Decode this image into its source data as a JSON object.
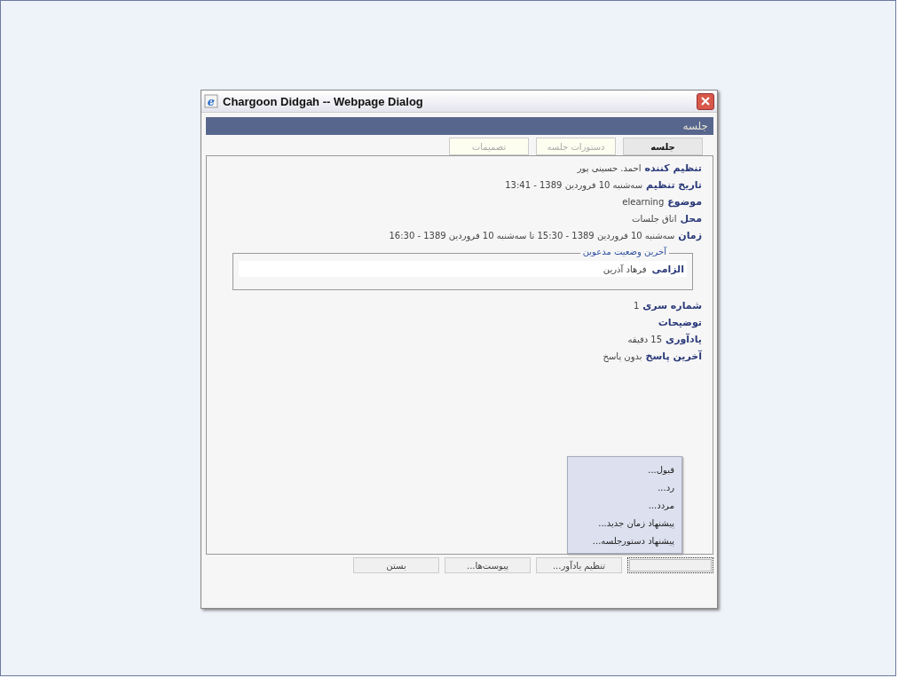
{
  "window": {
    "icon_letter": "e",
    "title": "Chargoon Didgah -- Webpage Dialog"
  },
  "header": {
    "title": "جلسه"
  },
  "tabs": [
    {
      "label": "جلسه",
      "selected": true
    },
    {
      "label": "دستورات جلسه",
      "selected": false
    },
    {
      "label": "تصمیمات",
      "selected": false
    }
  ],
  "fields_top": [
    {
      "label": "تنظیم کننده",
      "value": "احمد. حسینی پور"
    },
    {
      "label": "تاریخ تنظیم",
      "value": "سه‌شنبه 10 فروردین 1389 - 13:41"
    },
    {
      "label": "موضوع",
      "value": "elearning"
    },
    {
      "label": "محل",
      "value": "اتاق جلسات"
    },
    {
      "label": "زمان",
      "value": "سه‌شنبه 10 فروردین 1389 - 15:30 تا سه‌شنبه 10 فروردین 1389 - 16:30"
    }
  ],
  "invitees": {
    "legend": "آخرین وضعیت مدعوین",
    "rows": [
      {
        "status": "الزامی",
        "name": "فرهاد آذرین"
      }
    ]
  },
  "fields_bottom": [
    {
      "label": "شماره سری",
      "value": "1"
    },
    {
      "label": "توضیحات"
    },
    {
      "label": "یادآوری",
      "value": "15 دقیقه"
    },
    {
      "label": "آخرین پاسخ",
      "value": "بدون پاسخ"
    }
  ],
  "buttons": [
    {
      "focused": true
    },
    {
      "label": "تنظیم یادآور...",
      "focused": false
    },
    {
      "label": "پیوست‌ها...",
      "focused": false
    },
    {
      "label": "بستن",
      "focused": false
    }
  ],
  "menu": {
    "items": [
      "قبول...",
      "رد...",
      "مردد...",
      "پیشنهاد زمان جدید...",
      "پیشنهاد دستورجلسه..."
    ]
  }
}
